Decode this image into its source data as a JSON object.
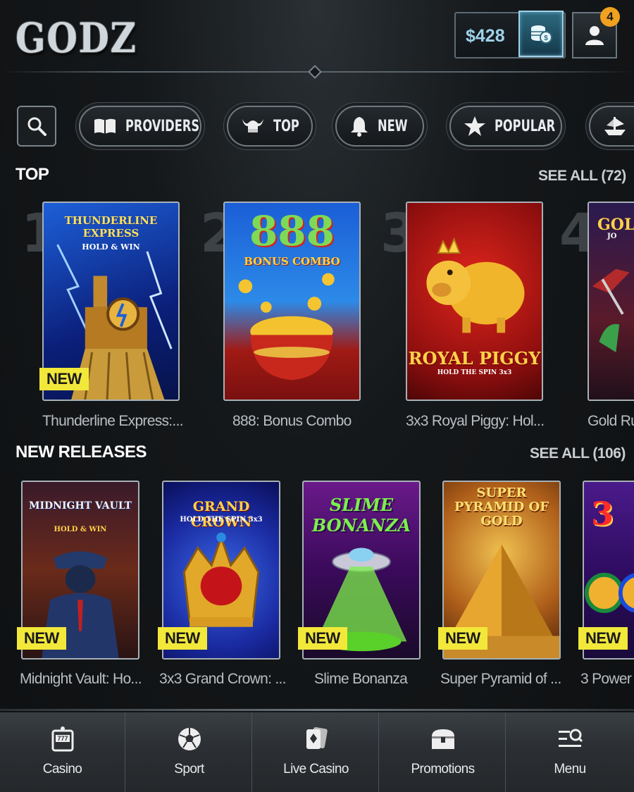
{
  "header": {
    "logo": "GODZ",
    "balance": "$428",
    "notification_count": "4"
  },
  "filters": [
    {
      "label": "PROVIDERS",
      "icon": "book-icon"
    },
    {
      "label": "TOP",
      "icon": "viking-helmet-icon"
    },
    {
      "label": "NEW",
      "icon": "bell-icon"
    },
    {
      "label": "POPULAR",
      "icon": "star-icon"
    },
    {
      "label": "",
      "icon": "ship-icon"
    }
  ],
  "top": {
    "title": "TOP",
    "see_all": "SEE ALL (72)",
    "games": [
      {
        "rank": "1",
        "name": "Thunderline Express:...",
        "art": "THUNDERLINE EXPRESS",
        "art_sub": "HOLD & WIN",
        "badge": "NEW"
      },
      {
        "rank": "2",
        "name": "888: Bonus Combo",
        "art": "888",
        "art_sub": "BONUS COMBO",
        "badge": ""
      },
      {
        "rank": "3",
        "name": "3x3 Royal Piggy: Hol...",
        "art": "ROYAL PIGGY",
        "art_sub": "HOLD THE SPIN 3x3",
        "badge": ""
      },
      {
        "rank": "4",
        "name": "Gold Ru",
        "art": "GOL",
        "art_sub": "JO",
        "badge": ""
      }
    ]
  },
  "new_releases": {
    "title": "NEW RELEASES",
    "see_all": "SEE ALL (106)",
    "games": [
      {
        "name": "Midnight Vault: Ho...",
        "art": "MIDNIGHT VAULT",
        "art_sub": "HOLD & WIN",
        "badge": "NEW"
      },
      {
        "name": "3x3 Grand Crown: ...",
        "art": "GRAND CROWN",
        "art_sub": "HOLD THE SPIN 3x3",
        "badge": "NEW"
      },
      {
        "name": "Slime Bonanza",
        "art": "SLIME BONANZA",
        "art_sub": "",
        "badge": "NEW"
      },
      {
        "name": "Super Pyramid of ...",
        "art": "SUPER PYRAMID OF GOLD",
        "art_sub": "",
        "badge": "NEW"
      },
      {
        "name": "3 Power",
        "art": "3",
        "art_sub": "",
        "badge": "NEW"
      }
    ]
  },
  "nav": [
    {
      "label": "Casino",
      "icon": "slot-machine-icon"
    },
    {
      "label": "Sport",
      "icon": "soccer-ball-icon"
    },
    {
      "label": "Live Casino",
      "icon": "playing-cards-icon"
    },
    {
      "label": "Promotions",
      "icon": "treasure-chest-icon"
    },
    {
      "label": "Menu",
      "icon": "menu-search-icon"
    }
  ],
  "colors": {
    "accent": "#9fd2ea",
    "badge": "#f2e83a",
    "notification": "#f0a11f"
  }
}
